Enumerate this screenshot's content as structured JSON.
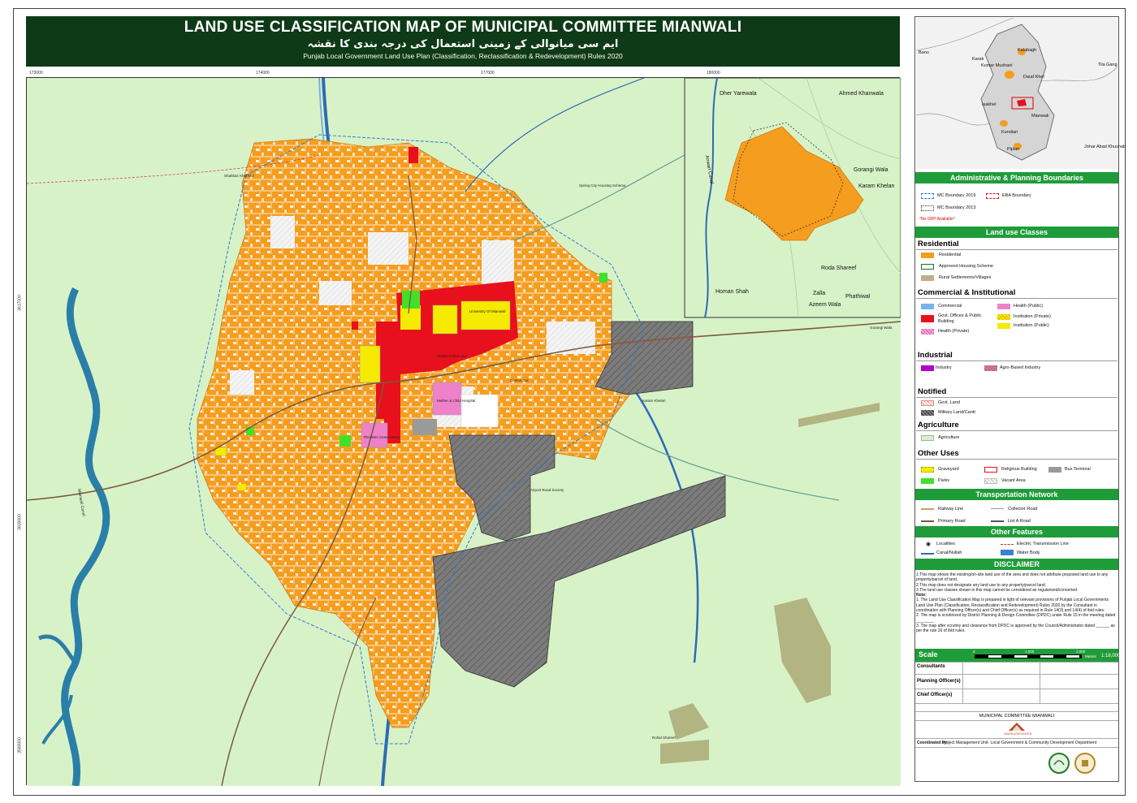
{
  "title": {
    "main": "LAND USE CLASSIFICATION MAP OF MUNICIPAL COMMITTEE MIANWALI",
    "urdu": "ایم سی میانوالی کے زمینی استعمال کی درجہ بندی کا نقشہ",
    "subtitle": "Punjab Local Government Land Use Plan (Classification, Reclassification & Redevelopment) Rules 2020"
  },
  "map": {
    "coords_top": [
      "173000",
      "174000",
      "177000",
      "180000"
    ],
    "coords_left": [
      "3617000",
      "3600000",
      "3580000"
    ],
    "labels": {
      "canal_left": "Mianwali Canal",
      "inset_label": "Anwari Canal",
      "karam_khelan": "Karam Khelan",
      "gorangi_wala": "Gorangi Wala",
      "airport_road": "Airport Road Society",
      "rohal_shareef": "Rohal Shareef",
      "university": "University Of Mianwali",
      "central_jail": "Central Jail",
      "district_jail": "District Police Line",
      "trauma": "TRAUMA Center DHQ",
      "general_hospital": "Mother & Child Hospital"
    },
    "inset_places": [
      "Dher Yarewala",
      "Ahmed Khanwala",
      "Gorangi Wala",
      "Karam Khelan",
      "Roda Shareef",
      "Homan Shah",
      "Zalla",
      "Phathiwal",
      "Azeem Wala"
    ]
  },
  "locator": {
    "places": [
      "Karak",
      "Kalabagh",
      "Banu",
      "Tila Gang",
      "Kumar Mushani",
      "Daud Khel",
      "Isakhel",
      "Mianwali",
      "Kundian",
      "Johar Abad Khushab",
      "Piplan"
    ]
  },
  "legend": {
    "admin_header": "Administrative & Planning Boundaries",
    "admin_items": [
      "MC Boundary 2019",
      "EBA Boundary",
      "MC Boundary 2013"
    ],
    "admin_note": "*No ODP Available*",
    "landuse_header": "Land use Classes",
    "residential_title": "Residential",
    "residential_items": [
      "Residential",
      "Approved Housing Scheme",
      "Rural Settlements/Villages"
    ],
    "commercial_title": "Commercial & Institutional",
    "commercial_items": [
      "Commercial",
      "Health (Public)",
      "Govt. Offices & Public Building",
      "Institution (Private)",
      "Health (Private)",
      "Institution (Public)"
    ],
    "industrial_title": "Industrial",
    "industrial_items": [
      "Industry",
      "Agro-Based Industry"
    ],
    "notified_title": "Notified",
    "notified_items": [
      "Govt. Land",
      "Military Land/Cantt"
    ],
    "agriculture_title": "Agriculture",
    "agriculture_items": [
      "Agriculture"
    ],
    "other_title": "Other Uses",
    "other_items": [
      "Graveyard",
      "Religious Building",
      "Bus Terminal",
      "Parks",
      "Vacant Area"
    ],
    "transport_header": "Transportation Network",
    "transport_items": [
      "Railway Line",
      "Collector Road",
      "Primary Road",
      "List A Road"
    ],
    "other_features_header": "Other Features",
    "feature_items": [
      "Localities",
      "Electric Transmission Line",
      "Canal/Nullah",
      "Water Body"
    ]
  },
  "disclaimer": {
    "header": "DISCLAIMER",
    "lines": [
      "1.This map shows the existing/on-site land use of the area and does not attribute proposed land use to any property/parcel of land.",
      "2.This map does not designate any land use to any property/parcel land.",
      "3.The land use classes shown in this map cannot be considered as regularized/converted.",
      "Note:",
      "1. The Land Use Classification Map is prepared in light of relevant provisions of Punjab Local Governments Land Use Plan (Classification, Reclassification and Redevelopment) Rules 2020 by the Consultant in coordination with Planning Officer(s) and Chief Officer(s) as required in Rule 14(3) and 14(4) of ibid rules.",
      "2. The map is scrutinized by District Planning & Design Committee (DPDC) under Rule 15 in the meeting dated ________",
      "3. The map after scrutiny and clearance from DPDC is approved by the Council/Administrator dated ______ as per the rule 16 of ibid rules."
    ]
  },
  "scale": {
    "label": "Scale",
    "ticks": [
      "0",
      "1,000",
      "2,000"
    ],
    "unit": "Meters",
    "ratio": "1:18,000"
  },
  "signoff": [
    "Consultants",
    "Planning Officer(s)",
    "Chief Officer(s)"
  ],
  "footer": {
    "committee": "MUNICIPAL COMMITTEE MIANWALI",
    "consultant_logo": "UNION ASSOCIATES",
    "coordinated_label": "Coordinated by:",
    "coordinated_text": "Project Management Unit- Local Government & Community Development Department"
  },
  "colors": {
    "title_bg": "#0e3a17",
    "header_green": "#1f9c3a",
    "agriculture": "#d8f2c8",
    "residential": "#f59d1e",
    "govt": "#e8101c",
    "institution_public": "#f5eb00",
    "military": "#8a8a8a",
    "canal": "#2e6ab5",
    "river": "#2a7fa8"
  }
}
